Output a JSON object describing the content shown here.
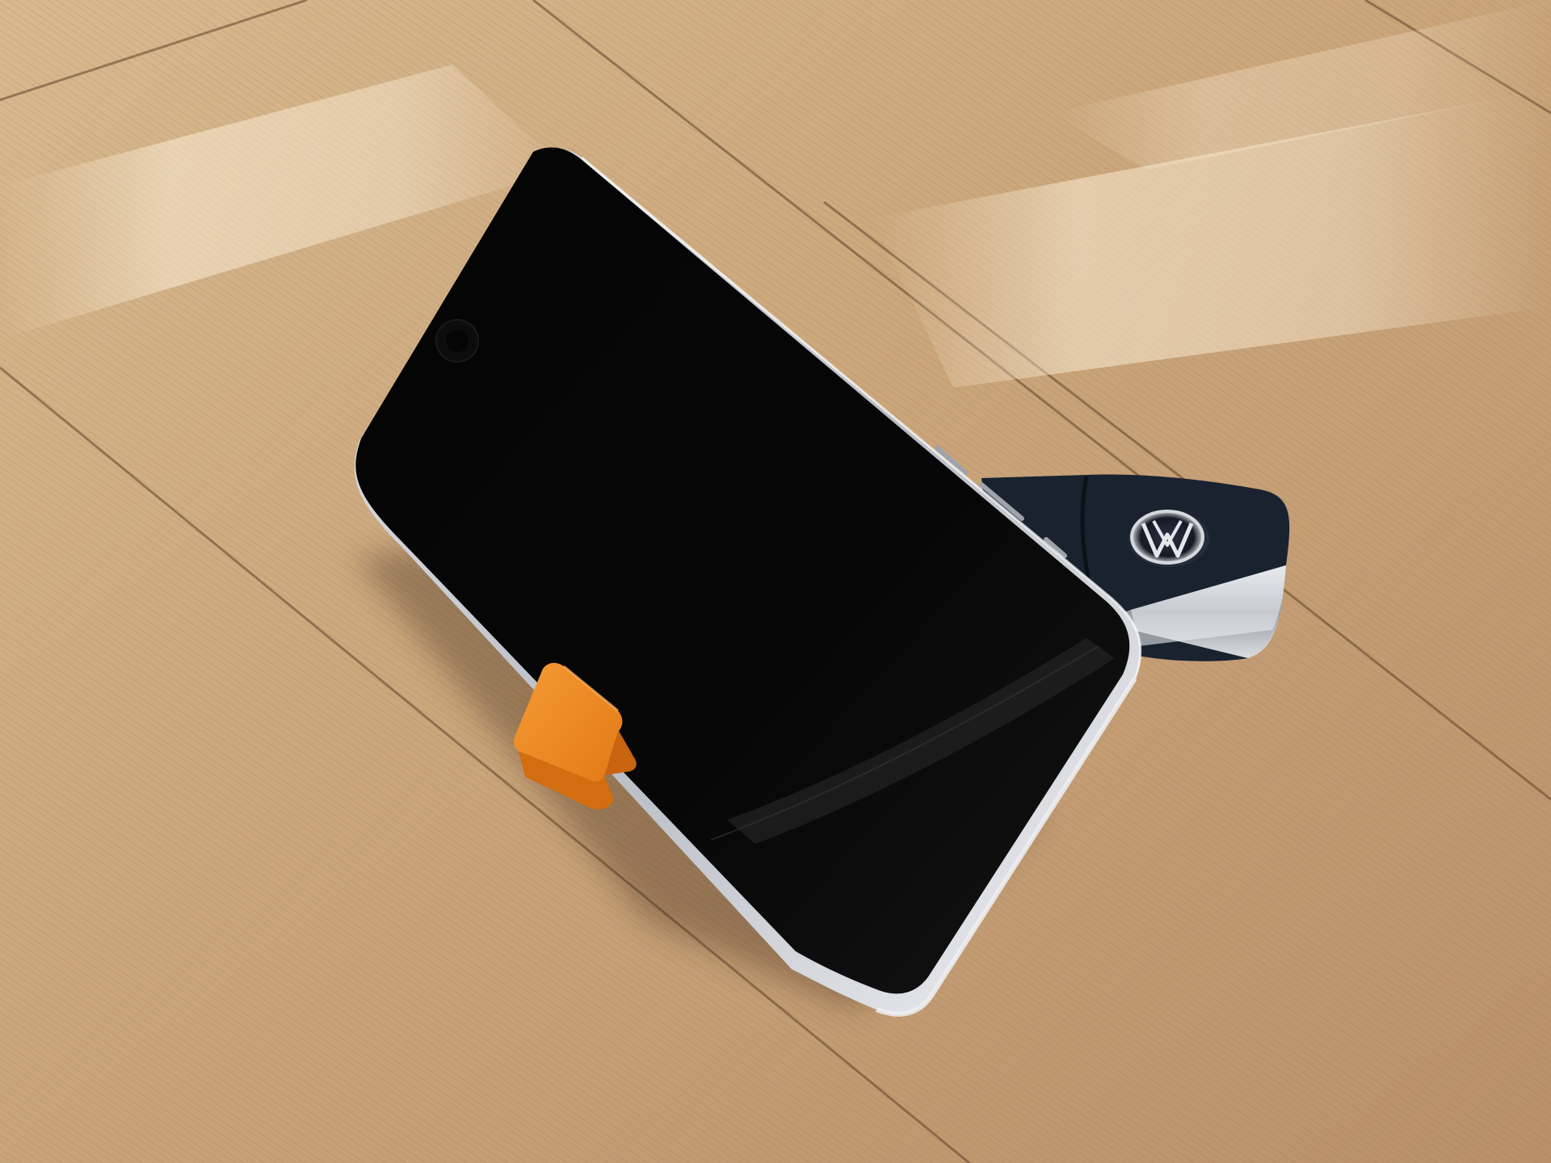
{
  "scene": {
    "subject": "smartphone-on-orange-stand",
    "objects": [
      {
        "name": "smartphone",
        "icon": "phone-icon"
      },
      {
        "name": "orange-phone-stand",
        "icon": "stand-icon"
      },
      {
        "name": "car-key-fob",
        "icon": "key-icon"
      },
      {
        "name": "vw-logo",
        "icon": "vw-emblem-icon"
      }
    ],
    "colors": {
      "wood_light": "#e2c49c",
      "wood_mid": "#c9a57a",
      "wood_dark": "#a67e55",
      "seam": "#5f432a",
      "phone_screen": "#050505",
      "phone_frame": "#d9dbe0",
      "stand_orange": "#ef8a24",
      "key_body": "#1a2230",
      "chrome": "#c8ccd2"
    }
  }
}
